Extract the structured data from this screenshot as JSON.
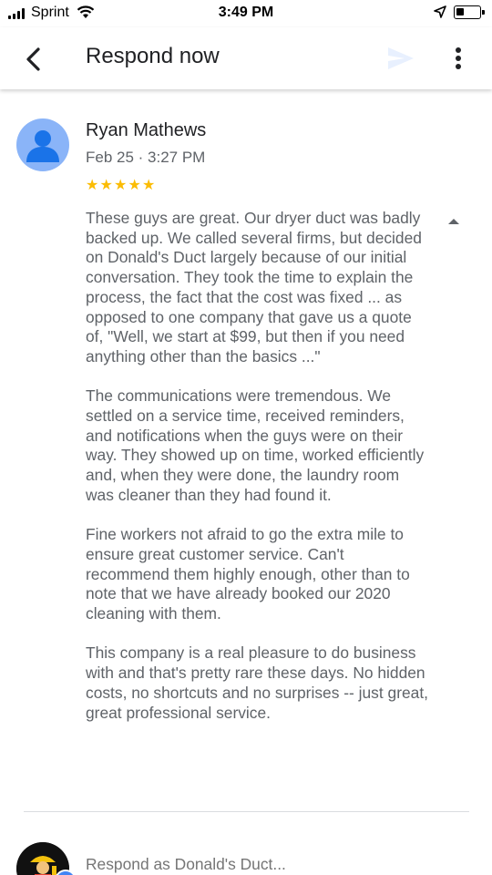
{
  "status_bar": {
    "carrier": "Sprint",
    "time": "3:49 PM",
    "icons": [
      "signal-icon",
      "wifi-icon",
      "location-arrow-icon",
      "battery-icon"
    ]
  },
  "app_bar": {
    "title": "Respond now",
    "icons": [
      "back-arrow-icon",
      "send-icon",
      "more-vert-icon"
    ]
  },
  "review": {
    "reviewer_name": "Ryan Mathews",
    "date": "Feb 25 · 3:27 PM",
    "rating": 5,
    "rating_max": 5,
    "star_color": "#fbbc04",
    "paragraphs": [
      "These guys are great. Our dryer duct was badly backed up. We called  several firms, but decided on Donald's Duct largely because of our initial conversation. They took the time to explain the process, the fact that the cost was fixed ... as opposed to one company that gave us a quote of, \"Well, we start at $99, but then if you need anything other than the basics ...\"",
      "The communications were tremendous. We settled on a service time, received reminders, and notifications when the guys were on their way. They showed up on time, worked efficiently and, when they were done, the laundry room was cleaner than they had found it.",
      "Fine workers not afraid to go the extra mile to ensure great customer service. Can't recommend them highly enough, other than to note that we have already booked our 2020 cleaning with them.",
      "This company is a real pleasure to do business with and that's pretty rare these days. No hidden costs, no shortcuts and no surprises -- just great, great professional service."
    ]
  },
  "respond": {
    "placeholder": "Respond as Donald's Duct..."
  },
  "colors": {
    "avatar_bg": "#8ab4f8",
    "avatar_fg": "#1a73e8",
    "body_text": "#5f6368",
    "title_text": "#202124"
  }
}
